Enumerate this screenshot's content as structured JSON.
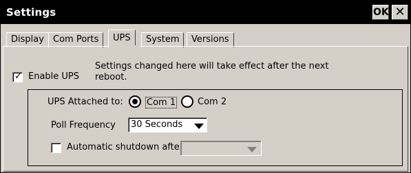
{
  "window": {
    "title": "Settings",
    "ok_label": "OK",
    "close_glyph": "✕"
  },
  "tabs": [
    {
      "label": "Display",
      "active": false
    },
    {
      "label": "Com Ports",
      "active": false
    },
    {
      "label": "UPS",
      "active": true
    },
    {
      "label": "System",
      "active": false
    },
    {
      "label": "Versions",
      "active": false
    }
  ],
  "ups": {
    "enable_label": "Enable UPS",
    "enable_checked": true,
    "notice_line1": "Settings changed here will take effect after the next",
    "notice_line2": "reboot.",
    "attached_label": "UPS Attached to:",
    "com_options": [
      {
        "label": "Com 1",
        "selected": true
      },
      {
        "label": "Com 2",
        "selected": false
      }
    ],
    "poll_label": "Poll Frequency",
    "poll_value": "30 Seconds",
    "shutdown_label": "Automatic shutdown after",
    "shutdown_checked": false,
    "shutdown_value": ""
  },
  "icons": {
    "check": "checkmark-icon",
    "dropdown": "chevron-down-icon"
  }
}
